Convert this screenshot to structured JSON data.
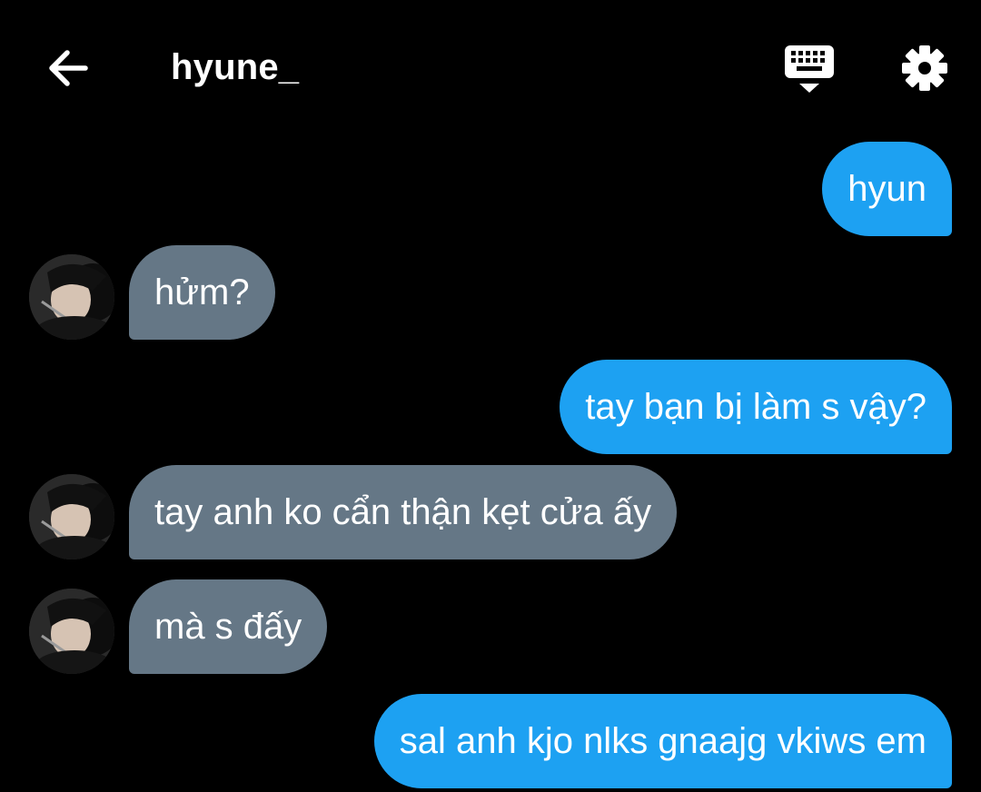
{
  "header": {
    "title": "hyune_",
    "back_icon": "arrow-left-icon",
    "keyboard_icon": "keyboard-hide-icon",
    "settings_icon": "gear-icon"
  },
  "colors": {
    "background": "#000000",
    "outgoing_bubble": "#1da1f2",
    "incoming_bubble": "#657786",
    "text": "#ffffff"
  },
  "messages": [
    {
      "sender": "me",
      "text": "hyun"
    },
    {
      "sender": "them",
      "text": "hửm?"
    },
    {
      "sender": "me",
      "text": "tay bạn bị làm s vậy?"
    },
    {
      "sender": "them",
      "text": "tay anh ko cẩn thận kẹt cửa ấy"
    },
    {
      "sender": "them",
      "text": "mà s đấy"
    },
    {
      "sender": "me",
      "text": "sal anh kjo nlks gnaajg vkiws em"
    }
  ]
}
